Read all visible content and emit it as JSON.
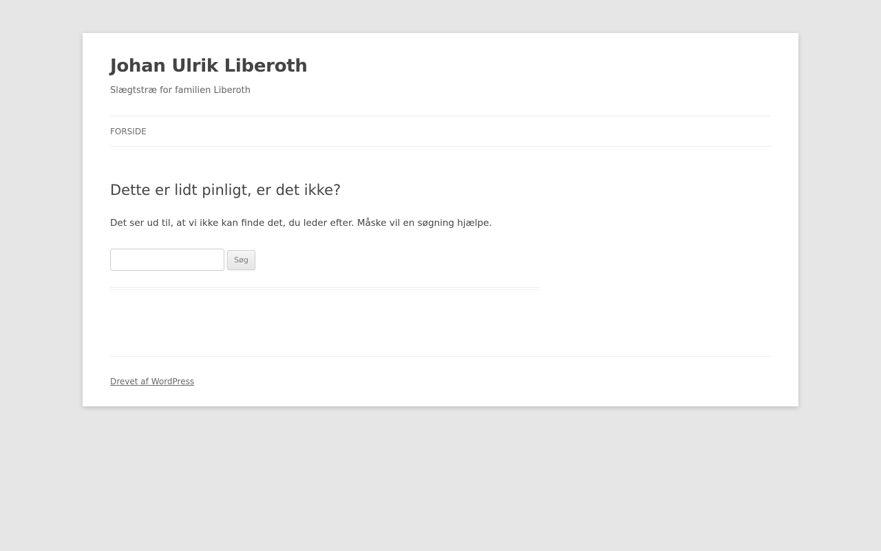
{
  "header": {
    "site_title": "Johan Ulrik Liberoth",
    "site_description": "Slægtstræ for familien Liberoth"
  },
  "nav": {
    "items": [
      {
        "label": "FORSIDE"
      }
    ]
  },
  "main": {
    "title": "Dette er lidt pinligt, er det ikke?",
    "message": "Det ser ud til, at vi ikke kan finde det, du leder efter. Måske vil en søgning hjælpe.",
    "search": {
      "value": "",
      "placeholder": "",
      "button_label": "Søg"
    }
  },
  "footer": {
    "credit_label": "Drevet af WordPress"
  },
  "colors": {
    "background": "#e6e6e6",
    "page": "#ffffff",
    "text": "#444444",
    "border": "#ededed"
  }
}
